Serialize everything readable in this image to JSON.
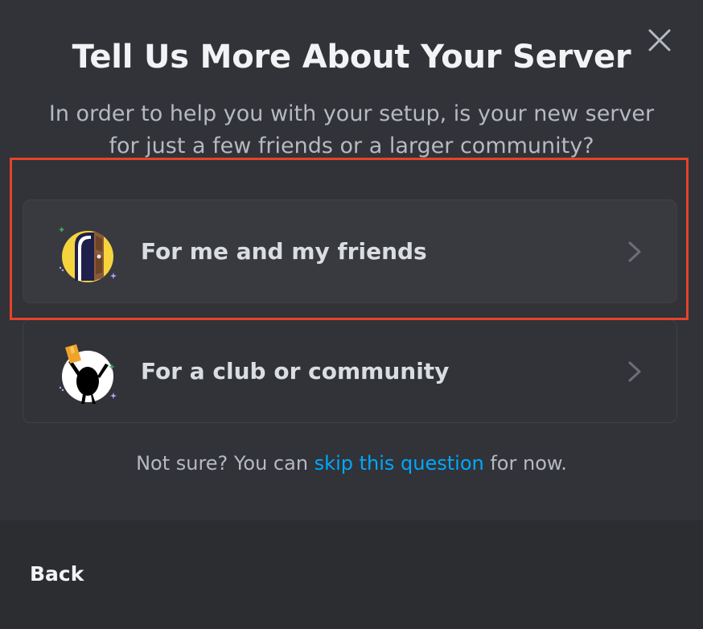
{
  "dialog": {
    "title": "Tell Us More About Your Server",
    "subtitle": "In order to help you with your setup, is your new server for just a few friends or a larger community?",
    "close_icon": "close-icon"
  },
  "options": [
    {
      "label": "For me and my friends",
      "icon": "friends-door-illustration",
      "chevron": "chevron-right-icon"
    },
    {
      "label": "For a club or community",
      "icon": "community-cheer-illustration",
      "chevron": "chevron-right-icon"
    }
  ],
  "skip": {
    "prefix": "Not sure? You can ",
    "link_text": "skip this question",
    "suffix": " for now."
  },
  "footer": {
    "back_label": "Back"
  },
  "colors": {
    "background": "#313338",
    "footer_background": "#2b2d31",
    "link": "#00a8fc",
    "highlight_outline": "#e5432a"
  }
}
